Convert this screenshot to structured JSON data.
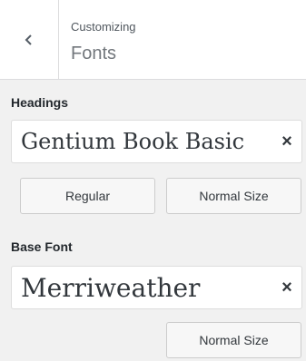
{
  "header": {
    "breadcrumb": "Customizing",
    "title": "Fonts"
  },
  "headings": {
    "label": "Headings",
    "font_name": "Gentium Book Basic",
    "clear_glyph": "×",
    "weight_button": "Regular",
    "size_button": "Normal Size"
  },
  "base_font": {
    "label": "Base Font",
    "font_name": "Merriweather",
    "clear_glyph": "×",
    "size_button": "Normal Size"
  }
}
